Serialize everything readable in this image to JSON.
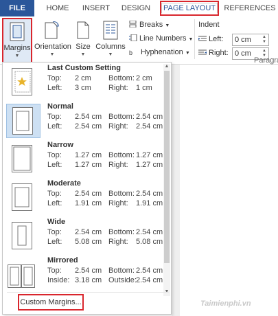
{
  "tabs": {
    "file": "FILE",
    "home": "HOME",
    "insert": "INSERT",
    "design": "DESIGN",
    "page_layout": "PAGE LAYOUT",
    "references": "REFERENCES"
  },
  "ribbon": {
    "margins": "Margins",
    "orientation": "Orientation",
    "size": "Size",
    "columns": "Columns",
    "breaks": "Breaks",
    "line_numbers": "Line Numbers",
    "hyphenation": "Hyphenation",
    "indent_title": "Indent",
    "left_label": "Left:",
    "right_label": "Right:",
    "left_value": "0 cm",
    "right_value": "0 cm",
    "paragraph_group": "Paragra"
  },
  "margins_menu": {
    "options": [
      {
        "name": "Last Custom Setting",
        "l1a": "Top:",
        "l1b": "2 cm",
        "l1c": "Bottom:",
        "l1d": "2 cm",
        "l2a": "Left:",
        "l2b": "3 cm",
        "l2c": "Right:",
        "l2d": "1 cm"
      },
      {
        "name": "Normal",
        "l1a": "Top:",
        "l1b": "2.54 cm",
        "l1c": "Bottom:",
        "l1d": "2.54 cm",
        "l2a": "Left:",
        "l2b": "2.54 cm",
        "l2c": "Right:",
        "l2d": "2.54 cm"
      },
      {
        "name": "Narrow",
        "l1a": "Top:",
        "l1b": "1.27 cm",
        "l1c": "Bottom:",
        "l1d": "1.27 cm",
        "l2a": "Left:",
        "l2b": "1.27 cm",
        "l2c": "Right:",
        "l2d": "1.27 cm"
      },
      {
        "name": "Moderate",
        "l1a": "Top:",
        "l1b": "2.54 cm",
        "l1c": "Bottom:",
        "l1d": "2.54 cm",
        "l2a": "Left:",
        "l2b": "1.91 cm",
        "l2c": "Right:",
        "l2d": "1.91 cm"
      },
      {
        "name": "Wide",
        "l1a": "Top:",
        "l1b": "2.54 cm",
        "l1c": "Bottom:",
        "l1d": "2.54 cm",
        "l2a": "Left:",
        "l2b": "5.08 cm",
        "l2c": "Right:",
        "l2d": "5.08 cm"
      },
      {
        "name": "Mirrored",
        "l1a": "Top:",
        "l1b": "2.54 cm",
        "l1c": "Bottom:",
        "l1d": "2.54 cm",
        "l2a": "Inside:",
        "l2b": "3.18 cm",
        "l2c": "Outside:",
        "l2d": "2.54 cm"
      }
    ],
    "custom_margins": "Custom Margins..."
  },
  "watermark": "Taimienphi.vn",
  "colors": {
    "accent": "#2b579a",
    "highlight_border": "#d9262d",
    "selected_bg": "#cde0f3"
  }
}
